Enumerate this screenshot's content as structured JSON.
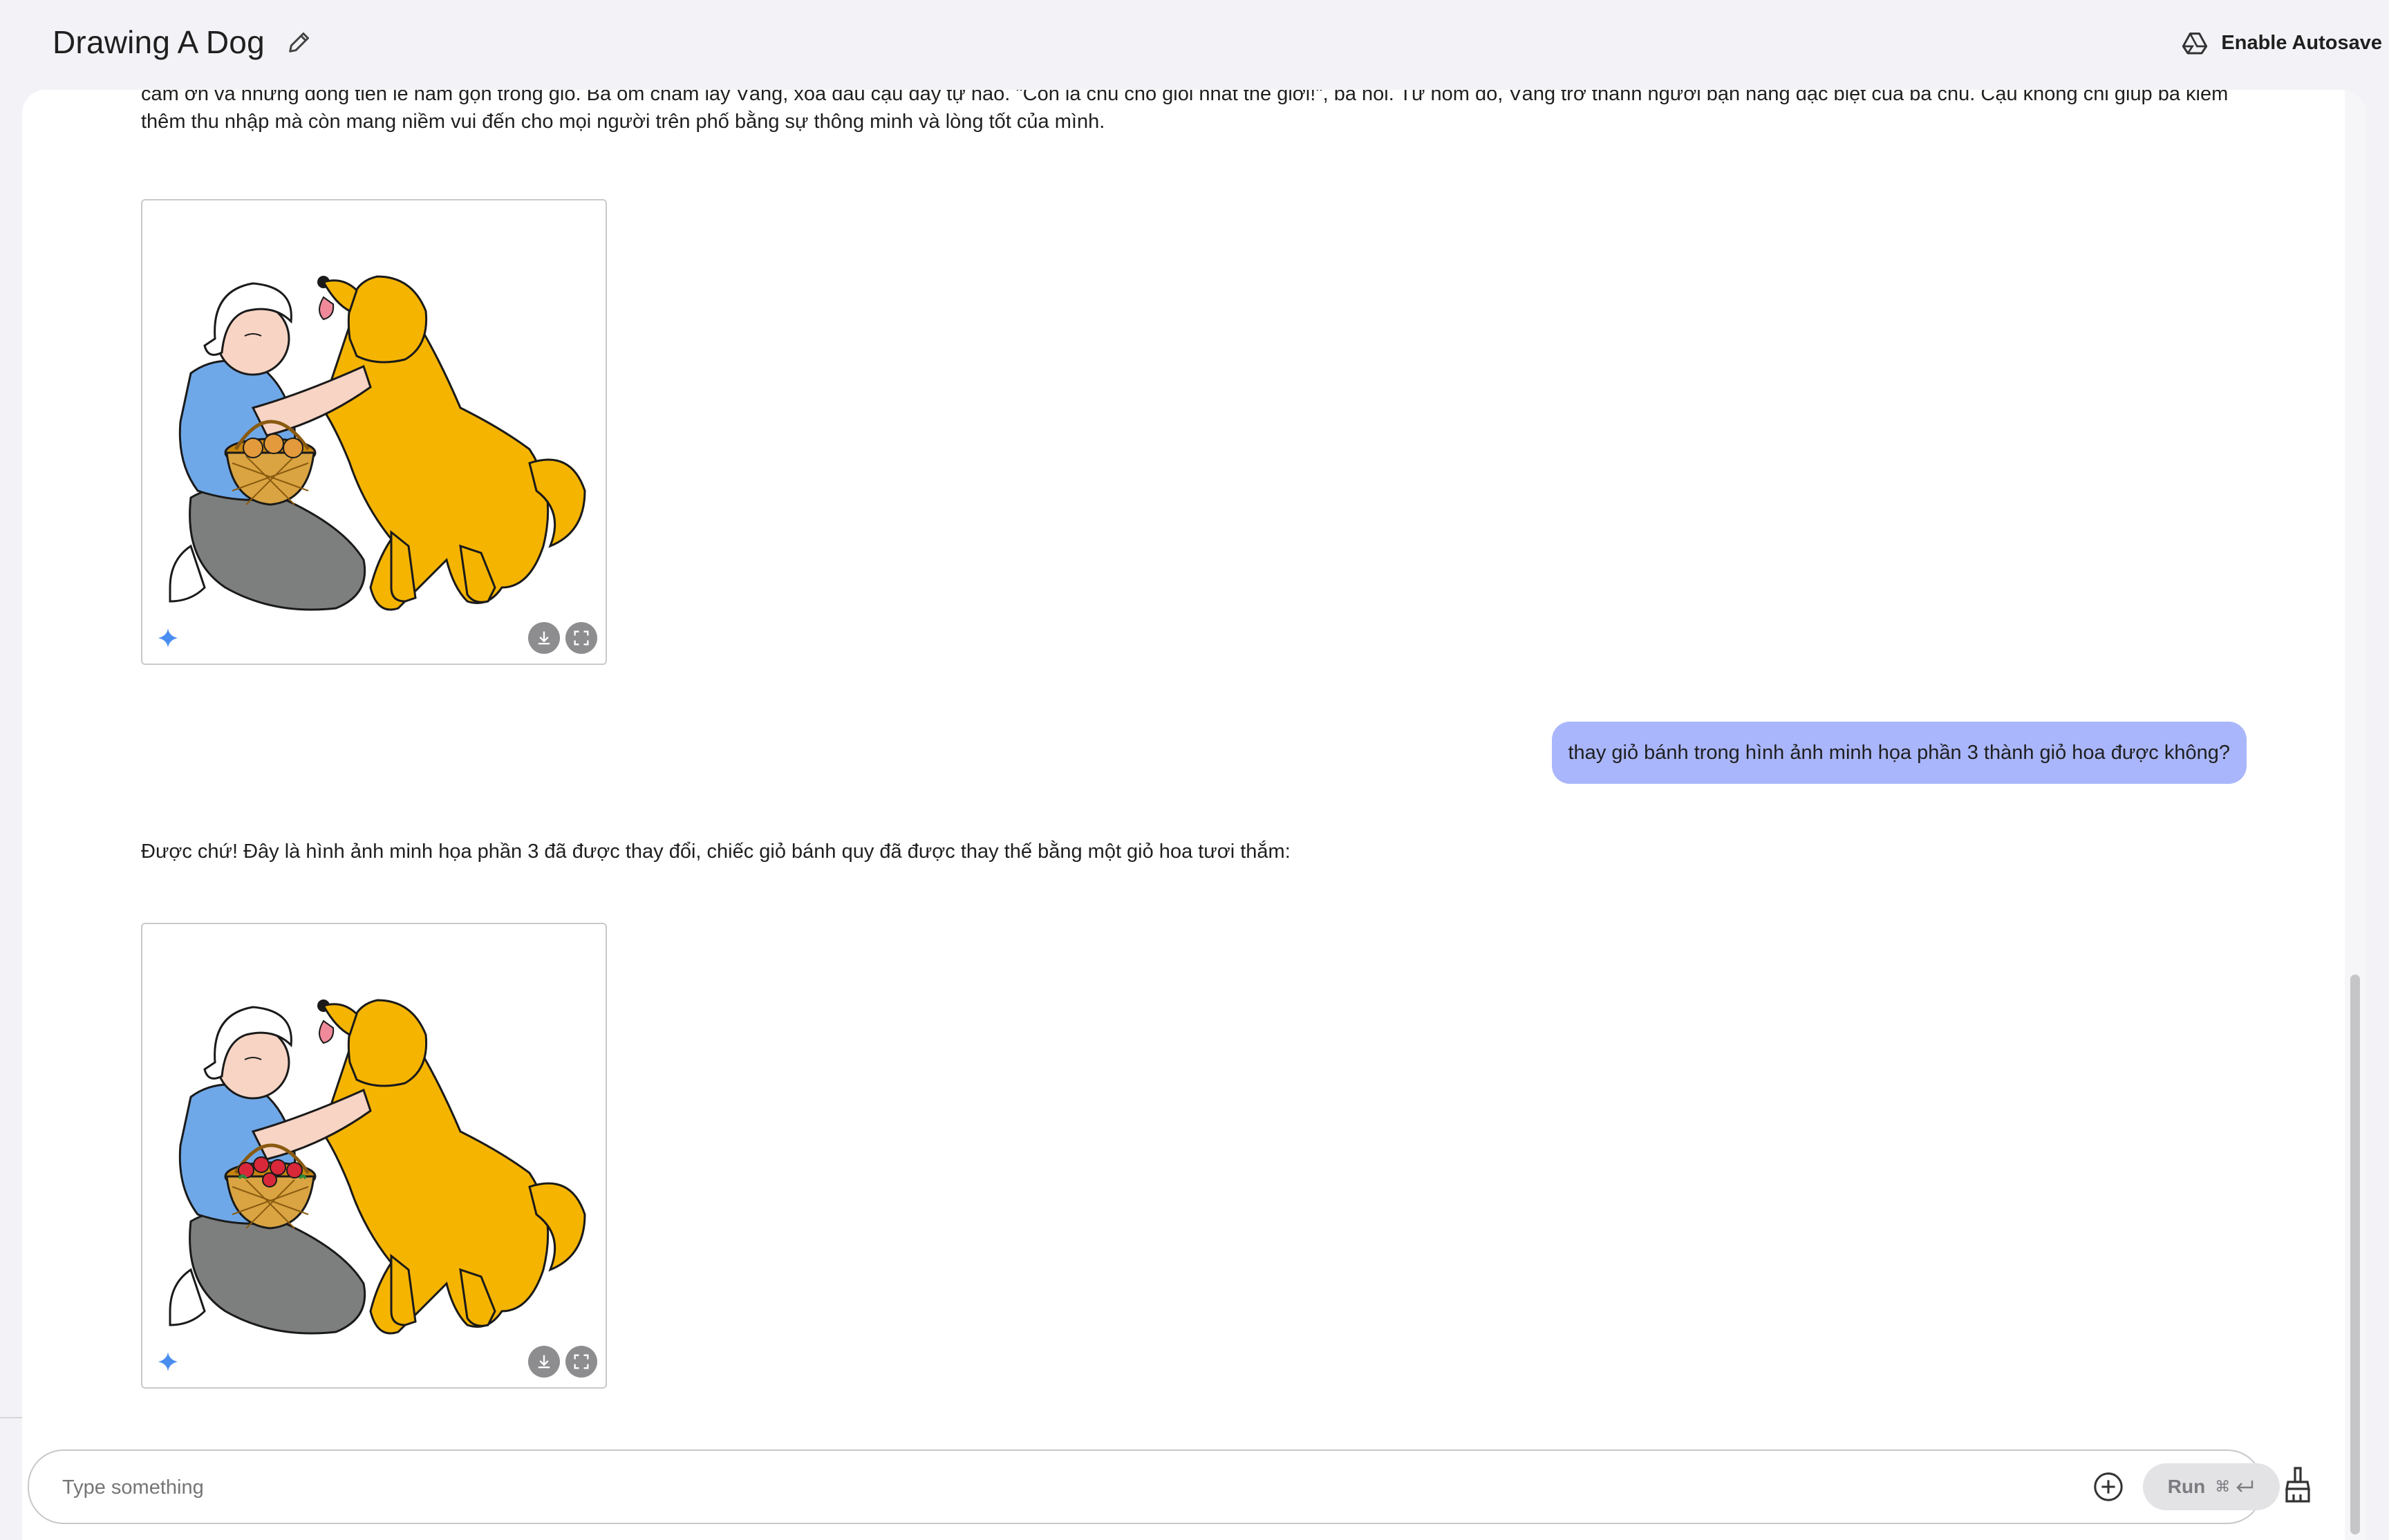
{
  "header": {
    "title": "Drawing A Dog",
    "autosave_label": "Enable Autosave"
  },
  "conversation": {
    "model_paragraph_top": "cảm ơn và những đồng tiền lẻ nằm gọn trong giỏ. Bà ôm chầm lấy Vàng, xoa đầu cậu đầy tự hào. \"Con là chú chó giỏi nhất thế giới!\", bà nói. Từ hôm đó, Vàng trở thành người bạn hàng đặc biệt của bà chủ. Cậu không chỉ giúp bà kiếm thêm thu nhập mà còn mang niềm vui đến cho mọi người trên phố bằng sự thông minh và lòng tốt của mình.",
    "user_message": "thay giỏ bánh trong hình ảnh minh họa phần 3 thành giỏ hoa được không?",
    "model_reply": "Được chứ! Đây là hình ảnh minh họa phần 3 đã được thay đổi, chiếc giỏ bánh quy đã được thay thế bằng một giỏ hoa tươi thắm:"
  },
  "composer": {
    "placeholder": "Type something",
    "run_label": "Run",
    "shortcut": "⌘"
  },
  "colors": {
    "user_bubble": "#aab6fb",
    "dog": "#f5b400",
    "shirt": "#6fa8e8",
    "pants": "#7d7f7e",
    "sparkle": "#4a8df0"
  }
}
